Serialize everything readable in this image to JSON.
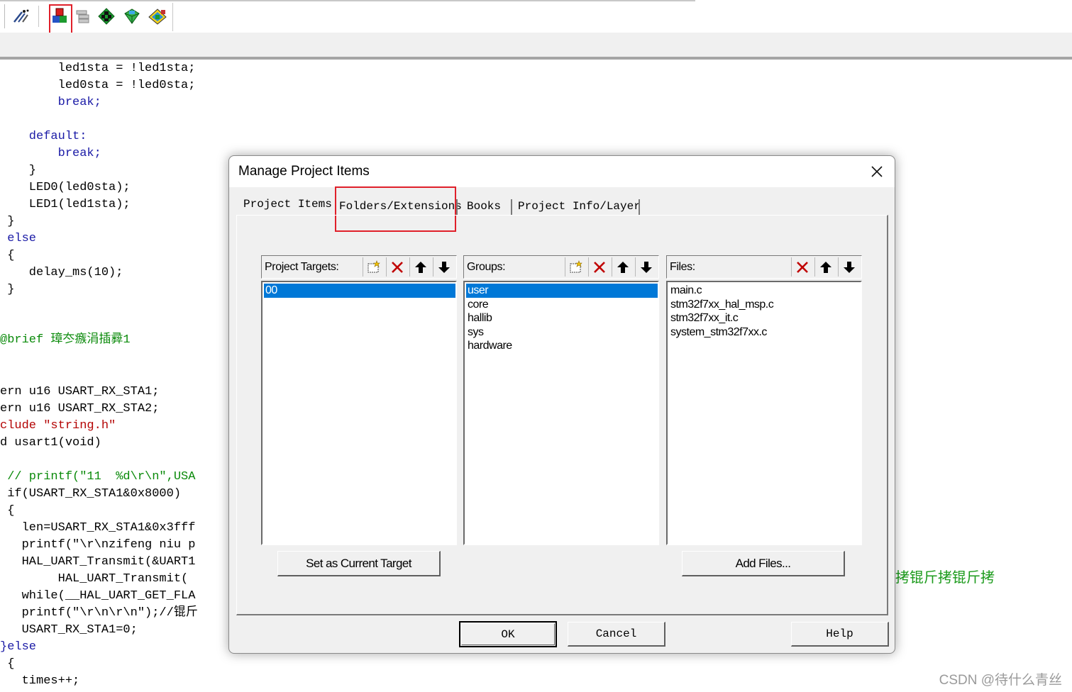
{
  "toolbar": {
    "icons": [
      "wizard-icon",
      "manage-project-items-icon",
      "batch-setup-icon",
      "load-icon",
      "pack-installer-icon",
      "select-software-packs-icon"
    ]
  },
  "code": {
    "lines": [
      "        led1sta = !led1sta;",
      "        led0sta = !led0sta;",
      "        break;",
      "",
      "    default:",
      "        break;",
      "    }",
      "    LED0(led0sta);",
      "    LED1(led1sta);",
      " }",
      " else",
      " {",
      "    delay_ms(10);",
      " }",
      "@brief 璋冭瘯涓插彛1",
      "ern u16 USART_RX_STA1;",
      "ern u16 USART_RX_STA2;",
      "clude \"string.h\"",
      "d usart1(void)",
      " // printf(\"11  %d\\r\\n\",USA",
      " if(USART_RX_STA1&0x8000)",
      " {",
      "   len=USART_RX_STA1&0x3fff",
      "   printf(\"\\r\\nzifeng niu p",
      "   HAL_UART_Transmit(&UART1",
      "        HAL_UART_Transmit(",
      "   while(__HAL_UART_GET_FLA",
      "   printf(\"\\r\\n\\r\\n\");//锟斤",
      "   USART_RX_STA1=0;",
      "}else",
      " {",
      "   times++;"
    ],
    "right_fragment": "拷锟斤拷锟斤拷"
  },
  "watermark": "CSDN @待什么青丝",
  "dialog": {
    "title": "Manage Project Items",
    "tabs": [
      "Project Items",
      "Folders/Extensions",
      "Books",
      "Project Info/Layer"
    ],
    "targets": {
      "label": "Project Targets:",
      "items": [
        "00"
      ],
      "selected": "00"
    },
    "groups": {
      "label": "Groups:",
      "items": [
        "user",
        "core",
        "hallib",
        "sys",
        "hardware"
      ],
      "selected": "user"
    },
    "files": {
      "label": "Files:",
      "items": [
        "main.c",
        "stm32f7xx_hal_msp.c",
        "stm32f7xx_it.c",
        "system_stm32f7xx.c"
      ]
    },
    "set_target_label": "Set as Current Target",
    "add_files_label": "Add Files...",
    "ok_label": "OK",
    "cancel_label": "Cancel",
    "help_label": "Help"
  },
  "colors": {
    "selection": "#0078d7",
    "highlight_box": "#e0202a",
    "keyword": "#1a1aa6",
    "comment": "#0a8a0a"
  }
}
